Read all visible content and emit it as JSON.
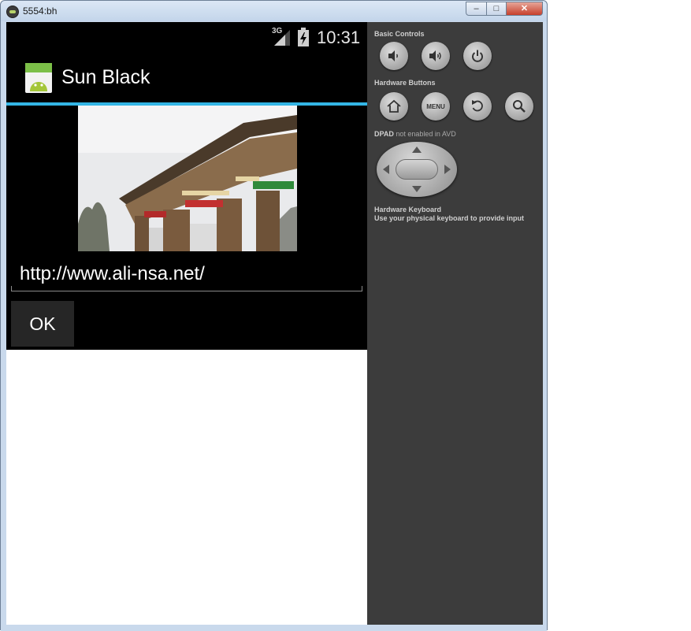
{
  "window": {
    "title": "5554:bh",
    "min_glyph": "–",
    "max_glyph": "□",
    "close_glyph": "✕"
  },
  "status_bar": {
    "network_type": "3G",
    "time": "10:31"
  },
  "app": {
    "title": "Sun Black",
    "url_value": "http://www.ali-nsa.net/",
    "ok_label": "OK",
    "accent_color": "#33b5e5"
  },
  "controls": {
    "basic_controls_label": "Basic Controls",
    "basic_controls": [
      "volume-down-icon",
      "volume-up-icon",
      "power-icon"
    ],
    "hardware_buttons_label": "Hardware Buttons",
    "hardware_buttons": [
      "home-icon",
      "MENU",
      "back-icon",
      "search-icon"
    ],
    "dpad_label": "DPAD",
    "dpad_note": "not enabled in AVD",
    "keyboard_title": "Hardware Keyboard",
    "keyboard_note": "Use your physical keyboard to provide input"
  }
}
